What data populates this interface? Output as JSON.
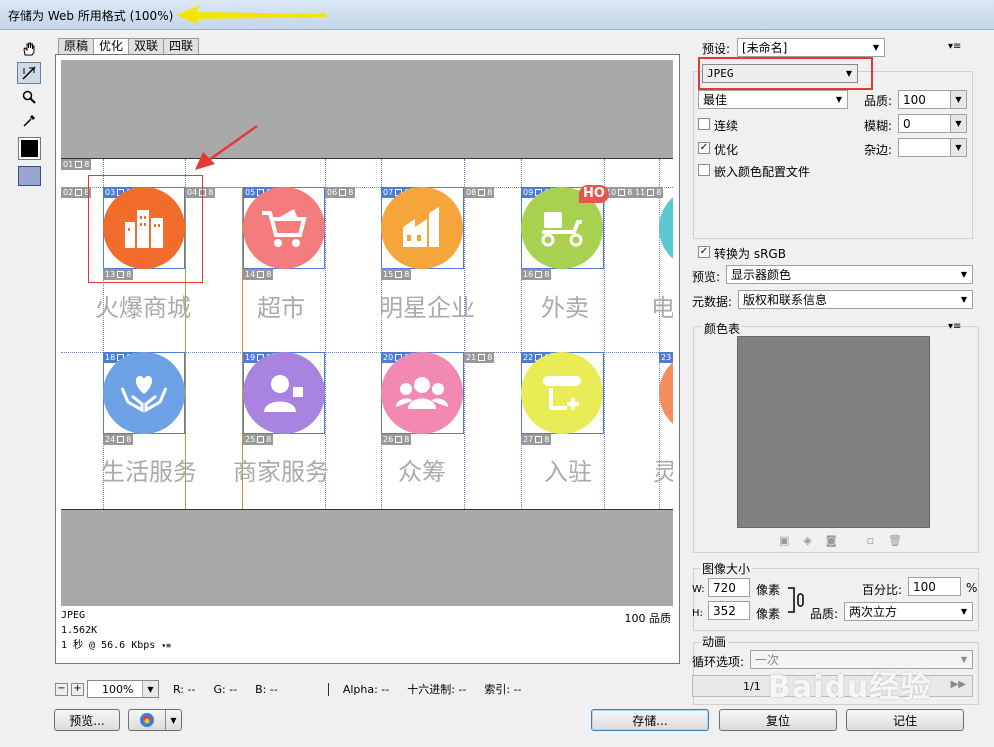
{
  "window": {
    "title": "存储为 Web 所用格式 (100%)"
  },
  "tabs": [
    {
      "label": "原稿"
    },
    {
      "label": "优化",
      "active": true
    },
    {
      "label": "双联"
    },
    {
      "label": "四联"
    }
  ],
  "canvas": {
    "icons": [
      {
        "label": "火爆商城",
        "color": "#f26d2c",
        "glyph": "city-icon"
      },
      {
        "label": "超市",
        "color": "#f57c7c",
        "glyph": "cart-icon"
      },
      {
        "label": "明星企业",
        "color": "#f6a53b",
        "glyph": "factory-icon"
      },
      {
        "label": "外卖",
        "color": "#a8d14f",
        "glyph": "scooter-icon"
      },
      {
        "label": "电",
        "color": "#5cc8d4",
        "glyph": "partial-icon"
      },
      {
        "label": "生活服务",
        "color": "#6da3e6",
        "glyph": "heart-hands-icon"
      },
      {
        "label": "商家服务",
        "color": "#a884e0",
        "glyph": "merchant-icon"
      },
      {
        "label": "众筹",
        "color": "#f289b1",
        "glyph": "people-icon"
      },
      {
        "label": "入驻",
        "color": "#eaec57",
        "glyph": "register-icon"
      },
      {
        "label": "灵",
        "color": "#f28f5c",
        "glyph": "partial-icon"
      }
    ],
    "slice_numbers": [
      "01",
      "02",
      "03",
      "04",
      "05",
      "06",
      "07",
      "08",
      "09",
      "10",
      "11",
      "13",
      "14",
      "15",
      "16",
      "18",
      "19",
      "20",
      "21",
      "22",
      "23",
      "24",
      "25",
      "26",
      "27"
    ],
    "hot_badge": "HO"
  },
  "info": {
    "format": "JPEG",
    "size": "1.562K",
    "speed": "1 秒 @ 56.6 Kbps",
    "quality": "100 品质"
  },
  "status": {
    "zoom": "100%",
    "r": "R: --",
    "g": "G: --",
    "b": "B: --",
    "alpha": "Alpha: --",
    "hex": "十六进制: --",
    "index": "索引: --"
  },
  "buttons": {
    "preview": "预览...",
    "save": "存储...",
    "reset": "复位",
    "remember": "记住"
  },
  "settings": {
    "preset_label": "预设:",
    "preset_value": "[未命名]",
    "format": "JPEG",
    "quality_preset": "最佳",
    "quality_label": "品质:",
    "quality_value": "100",
    "progressive": "连续",
    "blur_label": "模糊:",
    "blur_value": "0",
    "optimized": "优化",
    "matte_label": "杂边:",
    "matte_value": "",
    "embed_profile": "嵌入颜色配置文件",
    "convert_srgb": "转换为 sRGB",
    "preview_label": "预览:",
    "preview_value": "显示器颜色",
    "metadata_label": "元数据:",
    "metadata_value": "版权和联系信息",
    "color_table": "颜色表"
  },
  "image_size": {
    "header": "图像大小",
    "w_label": "W:",
    "w_value": "720",
    "h_label": "H:",
    "h_value": "352",
    "unit": "像素",
    "percent_label": "百分比:",
    "percent_value": "100",
    "percent_unit": "%",
    "quality_label": "品质:",
    "quality_value": "两次立方"
  },
  "animation": {
    "header": "动画",
    "loop_label": "循环选项:",
    "loop_value": "一次",
    "frame": "1/1"
  },
  "watermark": "Baidu经验"
}
